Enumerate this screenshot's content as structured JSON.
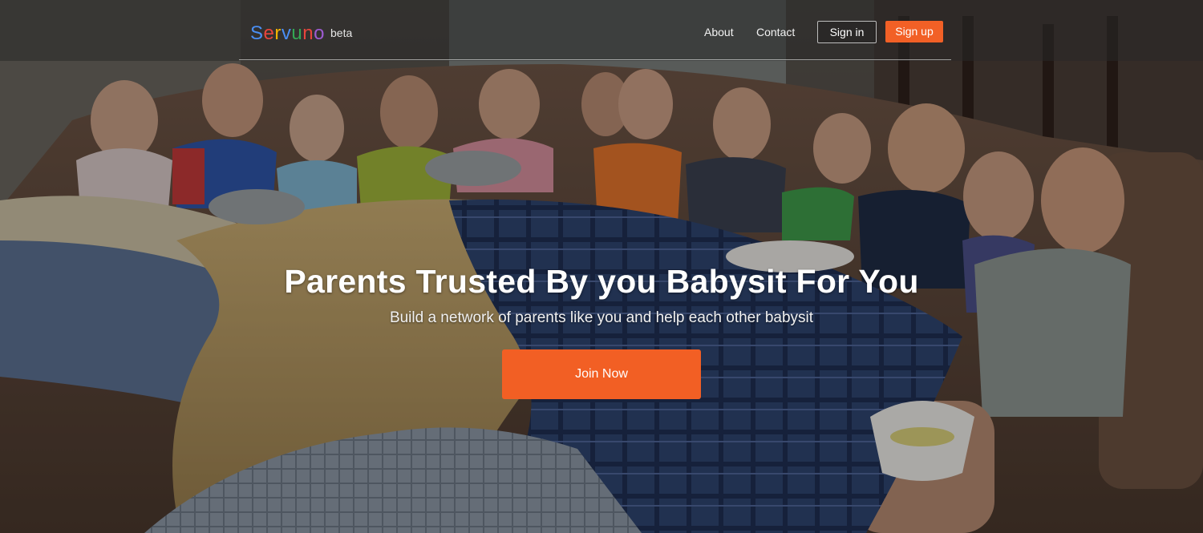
{
  "brand": {
    "letters": [
      {
        "char": "S",
        "color": "#4a8ff5"
      },
      {
        "char": "e",
        "color": "#e8453c"
      },
      {
        "char": "r",
        "color": "#f6b400"
      },
      {
        "char": "v",
        "color": "#4a8ff5"
      },
      {
        "char": "u",
        "color": "#34a853"
      },
      {
        "char": "n",
        "color": "#e8453c"
      },
      {
        "char": "o",
        "color": "#9d5bd2"
      }
    ],
    "tag": "beta"
  },
  "nav": {
    "about": "About",
    "contact": "Contact",
    "signin": "Sign in",
    "signup": "Sign up"
  },
  "hero": {
    "headline": "Parents Trusted By you Babysit For You",
    "subheadline": "Build a network of parents like you and help each other babysit",
    "cta": "Join Now"
  },
  "colors": {
    "accent": "#f25f24",
    "overlay": "rgba(0,0,0,0.28)"
  }
}
